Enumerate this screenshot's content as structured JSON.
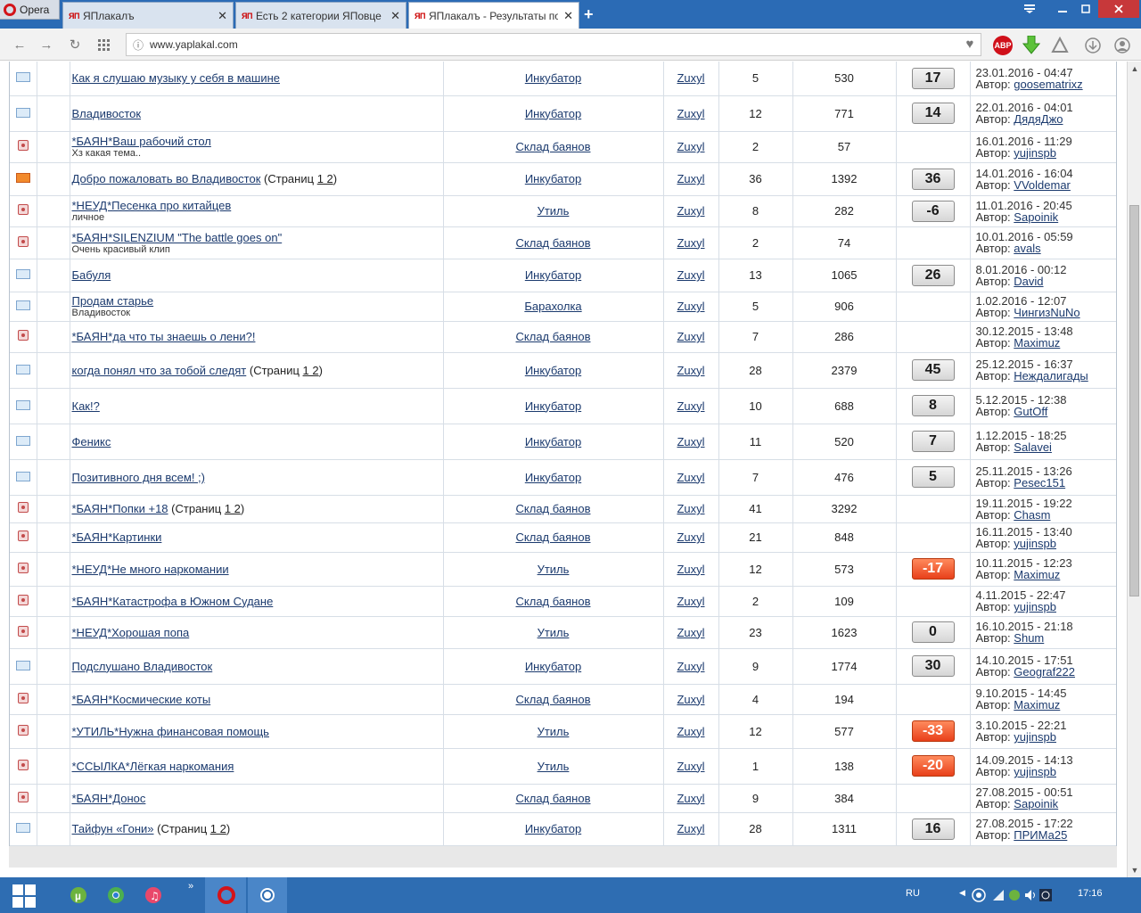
{
  "browser": {
    "menu_label": "Opera",
    "tabs": [
      {
        "favicon": "ЯП",
        "title": "ЯПлакалъ",
        "active": false
      },
      {
        "favicon": "ЯП",
        "title": "Есть 2 категории ЯПовце",
        "active": false
      },
      {
        "favicon": "ЯП",
        "title": "ЯПлакалъ - Результаты по",
        "active": true
      }
    ],
    "new_tab": "+",
    "close_glyph": "✕",
    "url": "www.yaplakal.com",
    "extensions": [
      "ABP",
      "download-arrow-icon",
      "vpn-icon",
      "downloads-icon",
      "account-icon"
    ]
  },
  "rows": [
    {
      "icon": "mail",
      "title": "Как я слушаю музыку у себя в машине",
      "subtitle": "",
      "pages": "",
      "forum": "Инкубатор",
      "author": "Zuxyl",
      "replies": "5",
      "views": "530",
      "rating": "17",
      "rating_negative": false,
      "last_date": "23.01.2016 - 04:47",
      "author_label": "Автор:",
      "last_author": "goosematrixz"
    },
    {
      "icon": "mail",
      "title": "Владивосток",
      "subtitle": "",
      "pages": "",
      "forum": "Инкубатор",
      "author": "Zuxyl",
      "replies": "12",
      "views": "771",
      "rating": "14",
      "rating_negative": false,
      "last_date": "22.01.2016 - 04:01",
      "author_label": "Автор:",
      "last_author": "ДядяДжо"
    },
    {
      "icon": "lock",
      "title": "*БАЯН*Ваш рабочий стол",
      "subtitle": "Хз какая тема..",
      "pages": "",
      "forum": "Склад баянов",
      "author": "Zuxyl",
      "replies": "2",
      "views": "57",
      "rating": "",
      "rating_negative": false,
      "last_date": "16.01.2016 - 11:29",
      "author_label": "Автор:",
      "last_author": "yujinspb"
    },
    {
      "icon": "hot",
      "title": "Добро пожаловать во Владивосток",
      "subtitle": "",
      "pages": "1 2",
      "forum": "Инкубатор",
      "author": "Zuxyl",
      "replies": "36",
      "views": "1392",
      "rating": "36",
      "rating_negative": false,
      "last_date": "14.01.2016 - 16:04",
      "author_label": "Автор:",
      "last_author": "VVoldemar"
    },
    {
      "icon": "lock",
      "title": "*НЕУД*Песенка про китайцев",
      "subtitle": "личное",
      "pages": "",
      "forum": "Утиль",
      "author": "Zuxyl",
      "replies": "8",
      "views": "282",
      "rating": "-6",
      "rating_negative": false,
      "last_date": "11.01.2016 - 20:45",
      "author_label": "Автор:",
      "last_author": "Sapoinik"
    },
    {
      "icon": "lock",
      "title": "*БАЯН*SILENZIUM \"The battle goes on\"",
      "subtitle": "Очень красивый клип",
      "pages": "",
      "forum": "Склад баянов",
      "author": "Zuxyl",
      "replies": "2",
      "views": "74",
      "rating": "",
      "rating_negative": false,
      "last_date": "10.01.2016 - 05:59",
      "author_label": "Автор:",
      "last_author": "avals"
    },
    {
      "icon": "mail",
      "title": "Бабуля",
      "subtitle": "",
      "pages": "",
      "forum": "Инкубатор",
      "author": "Zuxyl",
      "replies": "13",
      "views": "1065",
      "rating": "26",
      "rating_negative": false,
      "last_date": "8.01.2016 - 00:12",
      "author_label": "Автор:",
      "last_author": "David"
    },
    {
      "icon": "mail",
      "title": "Продам старье",
      "subtitle": "Владивосток",
      "pages": "",
      "forum": "Барахолка",
      "author": "Zuxyl",
      "replies": "5",
      "views": "906",
      "rating": "",
      "rating_negative": false,
      "last_date": "1.02.2016 - 12:07",
      "author_label": "Автор:",
      "last_author": "ЧингизNuNo"
    },
    {
      "icon": "lock",
      "title": "*БАЯН*да что ты знаешь о лени?!",
      "subtitle": "",
      "pages": "",
      "forum": "Склад баянов",
      "author": "Zuxyl",
      "replies": "7",
      "views": "286",
      "rating": "",
      "rating_negative": false,
      "last_date": "30.12.2015 - 13:48",
      "author_label": "Автор:",
      "last_author": "Maximuz"
    },
    {
      "icon": "mail",
      "title": "когда понял что за тобой следят",
      "subtitle": "",
      "pages": "1 2",
      "forum": "Инкубатор",
      "author": "Zuxyl",
      "replies": "28",
      "views": "2379",
      "rating": "45",
      "rating_negative": false,
      "last_date": "25.12.2015 - 16:37",
      "author_label": "Автор:",
      "last_author": "Неждалигады"
    },
    {
      "icon": "mail",
      "title": "Как!?",
      "subtitle": "",
      "pages": "",
      "forum": "Инкубатор",
      "author": "Zuxyl",
      "replies": "10",
      "views": "688",
      "rating": "8",
      "rating_negative": false,
      "last_date": "5.12.2015 - 12:38",
      "author_label": "Автор:",
      "last_author": "GutOff"
    },
    {
      "icon": "mail",
      "title": "Феникс",
      "subtitle": "",
      "pages": "",
      "forum": "Инкубатор",
      "author": "Zuxyl",
      "replies": "11",
      "views": "520",
      "rating": "7",
      "rating_negative": false,
      "last_date": "1.12.2015 - 18:25",
      "author_label": "Автор:",
      "last_author": "Salavei"
    },
    {
      "icon": "mail",
      "title": "Позитивного дня всем! ;)",
      "subtitle": "",
      "pages": "",
      "forum": "Инкубатор",
      "author": "Zuxyl",
      "replies": "7",
      "views": "476",
      "rating": "5",
      "rating_negative": false,
      "last_date": "25.11.2015 - 13:26",
      "author_label": "Автор:",
      "last_author": "Pesec151"
    },
    {
      "icon": "lock",
      "title": "*БАЯН*Попки +18",
      "subtitle": "",
      "pages": "1 2",
      "forum": "Склад баянов",
      "author": "Zuxyl",
      "replies": "41",
      "views": "3292",
      "rating": "",
      "rating_negative": false,
      "last_date": "19.11.2015 - 19:22",
      "author_label": "Автор:",
      "last_author": "Chasm"
    },
    {
      "icon": "lock",
      "title": "*БАЯН*Картинки",
      "subtitle": "",
      "pages": "",
      "forum": "Склад баянов",
      "author": "Zuxyl",
      "replies": "21",
      "views": "848",
      "rating": "",
      "rating_negative": false,
      "last_date": "16.11.2015 - 13:40",
      "author_label": "Автор:",
      "last_author": "yujinspb"
    },
    {
      "icon": "lock",
      "title": "*НЕУД*Не много наркомании",
      "subtitle": "",
      "pages": "",
      "forum": "Утиль",
      "author": "Zuxyl",
      "replies": "12",
      "views": "573",
      "rating": "-17",
      "rating_negative": true,
      "last_date": "10.11.2015 - 12:23",
      "author_label": "Автор:",
      "last_author": "Maximuz"
    },
    {
      "icon": "lock",
      "title": "*БАЯН*Катастрофа в Южном Судане",
      "subtitle": "",
      "pages": "",
      "forum": "Склад баянов",
      "author": "Zuxyl",
      "replies": "2",
      "views": "109",
      "rating": "",
      "rating_negative": false,
      "last_date": "4.11.2015 - 22:47",
      "author_label": "Автор:",
      "last_author": "yujinspb"
    },
    {
      "icon": "lock",
      "title": "*НЕУД*Хорошая попа",
      "subtitle": "",
      "pages": "",
      "forum": "Утиль",
      "author": "Zuxyl",
      "replies": "23",
      "views": "1623",
      "rating": "0",
      "rating_negative": false,
      "last_date": "16.10.2015 - 21:18",
      "author_label": "Автор:",
      "last_author": "Shum"
    },
    {
      "icon": "mail",
      "title": "Подслушано Владивосток",
      "subtitle": "",
      "pages": "",
      "forum": "Инкубатор",
      "author": "Zuxyl",
      "replies": "9",
      "views": "1774",
      "rating": "30",
      "rating_negative": false,
      "last_date": "14.10.2015 - 17:51",
      "author_label": "Автор:",
      "last_author": "Geograf222"
    },
    {
      "icon": "lock",
      "title": "*БАЯН*Космические коты",
      "subtitle": "",
      "pages": "",
      "forum": "Склад баянов",
      "author": "Zuxyl",
      "replies": "4",
      "views": "194",
      "rating": "",
      "rating_negative": false,
      "last_date": "9.10.2015 - 14:45",
      "author_label": "Автор:",
      "last_author": "Maximuz"
    },
    {
      "icon": "lock",
      "title": "*УТИЛЬ*Нужна финансовая помощь",
      "subtitle": "",
      "pages": "",
      "forum": "Утиль",
      "author": "Zuxyl",
      "replies": "12",
      "views": "577",
      "rating": "-33",
      "rating_negative": true,
      "last_date": "3.10.2015 - 22:21",
      "author_label": "Автор:",
      "last_author": "yujinspb"
    },
    {
      "icon": "lock",
      "title": "*ССЫЛКА*Лёгкая наркомания",
      "subtitle": "",
      "pages": "",
      "forum": "Утиль",
      "author": "Zuxyl",
      "replies": "1",
      "views": "138",
      "rating": "-20",
      "rating_negative": true,
      "last_date": "14.09.2015 - 14:13",
      "author_label": "Автор:",
      "last_author": "yujinspb"
    },
    {
      "icon": "lock",
      "title": "*БАЯН*Донос",
      "subtitle": "",
      "pages": "",
      "forum": "Склад баянов",
      "author": "Zuxyl",
      "replies": "9",
      "views": "384",
      "rating": "",
      "rating_negative": false,
      "last_date": "27.08.2015 - 00:51",
      "author_label": "Автор:",
      "last_author": "Sapoinik"
    },
    {
      "icon": "mail",
      "title": "Тайфун «Гони»",
      "subtitle": "",
      "pages": "1 2",
      "forum": "Инкубатор",
      "author": "Zuxyl",
      "replies": "28",
      "views": "1311",
      "rating": "16",
      "rating_negative": false,
      "last_date": "27.08.2015 - 17:22",
      "author_label": "Автор:",
      "last_author": "ПРИМа25"
    }
  ],
  "pages_prefix": "(Страниц",
  "pages_suffix": ")",
  "taskbar": {
    "language": "RU",
    "time": "17:16",
    "overflow": "»"
  },
  "colors": {
    "tabbar": "#2b6bb5",
    "link": "#1b3a6e",
    "negative_rating": "#e8401a",
    "taskbar": "#2e6db2"
  }
}
